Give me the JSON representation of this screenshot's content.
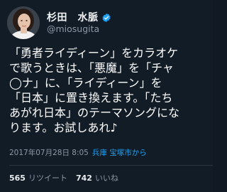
{
  "author": {
    "display_name": "杉田　水脈",
    "handle": "@miosugita",
    "verified": true,
    "avatar_icon": "profile-photo"
  },
  "tweet": {
    "lines": [
      "「勇者ライディーン」をカラオケ",
      "で歌うときは、「悪魔」を「チャ",
      "◯ナ」に、「ライディーン」を",
      "「日本」に置き換えます。「たち",
      "あがれ日本」のテーマソングにな",
      "ります。お試しあれ♪"
    ]
  },
  "meta": {
    "timestamp": "2017年07月28日 8:05",
    "location": "兵庫 宝塚市から"
  },
  "stats": {
    "retweets_count": "565",
    "retweets_label": "リツイート",
    "likes_count": "742",
    "likes_label": "いいね"
  },
  "colors": {
    "background": "#121c26",
    "link": "#1da1f2",
    "muted": "#8b98a5",
    "verified": "#1da1f2"
  }
}
